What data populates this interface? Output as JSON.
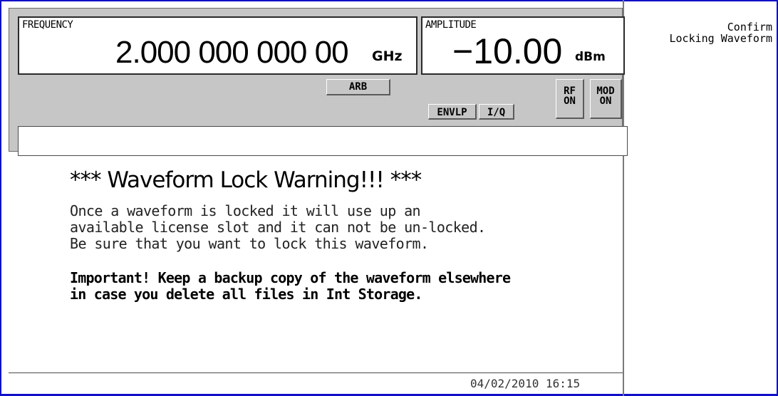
{
  "status": {
    "frequency_label": "FREQUENCY",
    "frequency_value": "2.000 000 000 00",
    "frequency_unit": "GHz",
    "amplitude_label": "AMPLITUDE",
    "amplitude_value": "−10.00",
    "amplitude_unit": "dBm",
    "annunciators": {
      "arb": "ARB",
      "envlp": "ENVLP",
      "iq": "I/Q",
      "rf_line1": "RF",
      "rf_line2": "ON",
      "mod_line1": "MOD",
      "mod_line2": "ON"
    },
    "message": ""
  },
  "dialog": {
    "title": "*** Waveform Lock Warning!!! ***",
    "body_lines": [
      "Once a waveform is locked it will use up an",
      "available license slot and it can not be un-locked.",
      "Be sure that you want to lock this waveform."
    ],
    "important_lines": [
      "Important! Keep a backup copy of the waveform elsewhere",
      "in case you delete all files in Int Storage."
    ]
  },
  "datetime": "04/02/2010 16:15",
  "softkey": {
    "line1": "Confirm",
    "line2": "Locking Waveform"
  },
  "colors": {
    "frame_border": "#1010c8",
    "panel_gray": "#c6c6c6"
  }
}
